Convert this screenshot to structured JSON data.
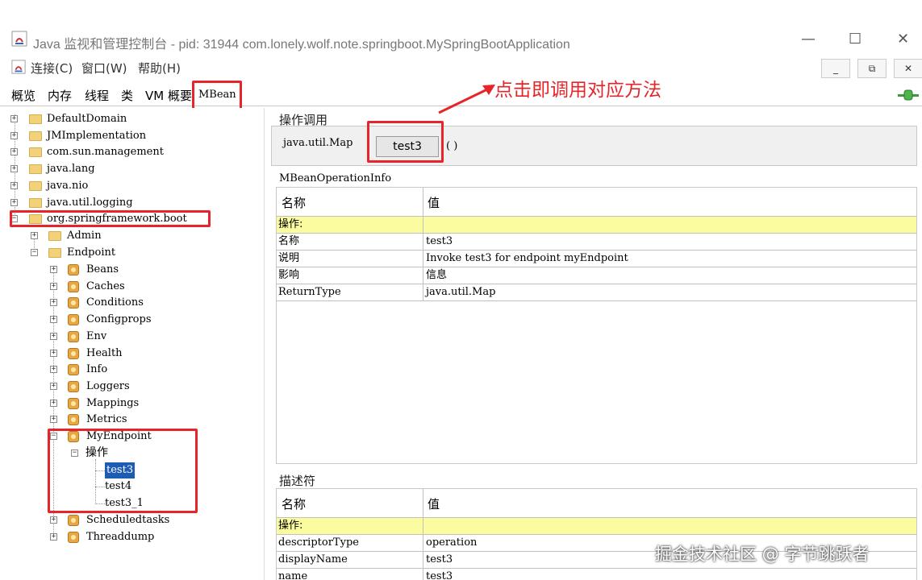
{
  "window": {
    "title": "Java 监视和管理控制台 - pid: 31944 com.lonely.wolf.note.springboot.MySpringBootApplication",
    "controls": [
      "—",
      "☐",
      "✕"
    ]
  },
  "menu": {
    "items": [
      "连接(C)",
      "窗口(W)",
      "帮助(H)"
    ],
    "inner_controls": [
      "_",
      "⧉",
      "✕"
    ]
  },
  "tabs": [
    "概览",
    "内存",
    "线程",
    "类",
    "VM 概要",
    "MBean"
  ],
  "annotation": "点击即调用对应方法",
  "tree": {
    "roots": [
      "DefaultDomain",
      "JMImplementation",
      "com.sun.management",
      "java.lang",
      "java.nio",
      "java.util.logging",
      "org.springframework.boot"
    ],
    "boot_children": [
      "Admin",
      "Endpoint"
    ],
    "endpoint_children": [
      "Beans",
      "Caches",
      "Conditions",
      "Configprops",
      "Env",
      "Health",
      "Info",
      "Loggers",
      "Mappings",
      "Metrics",
      "MyEndpoint",
      "Scheduledtasks",
      "Threaddump"
    ],
    "ops_label": "操作",
    "operations": [
      "test3",
      "test4",
      "test3_1"
    ]
  },
  "invoke": {
    "section_title": "操作调用",
    "return_type": "java.util.Map",
    "button": "test3",
    "params": "( )"
  },
  "info": {
    "section_title": "MBeanOperationInfo",
    "header": [
      "名称",
      "值"
    ],
    "group": "操作:",
    "rows": [
      [
        "名称",
        "test3"
      ],
      [
        "说明",
        "Invoke test3 for endpoint myEndpoint"
      ],
      [
        "影响",
        "信息"
      ],
      [
        "ReturnType",
        "java.util.Map"
      ]
    ]
  },
  "descriptor": {
    "section_title": "描述符",
    "header": [
      "名称",
      "值"
    ],
    "group": "操作:",
    "rows": [
      [
        "descriptorType",
        "operation"
      ],
      [
        "displayName",
        "test3"
      ],
      [
        "name",
        "test3"
      ]
    ]
  },
  "watermark": "掘金技术社区 @ 字节跳跃者",
  "colors": {
    "highlight": "#e5252a",
    "selection": "#1e5bb3",
    "group_row": "#fbfba0"
  }
}
